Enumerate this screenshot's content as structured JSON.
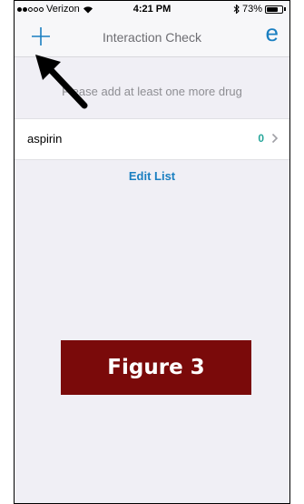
{
  "status_bar": {
    "carrier": "Verizon",
    "time": "4:21 PM",
    "battery": "73%",
    "battery_level": 0.73
  },
  "nav": {
    "title": "Interaction Check",
    "logo_text": "e"
  },
  "hint": "Please add at least one more drug",
  "drugs": [
    {
      "name": "aspirin",
      "count": "0"
    }
  ],
  "edit_list_label": "Edit List",
  "figure_label": "Figure 3",
  "colors": {
    "accent": "#1a7fc1",
    "count": "#26a69a",
    "figure_bg": "#7a0a0a"
  }
}
